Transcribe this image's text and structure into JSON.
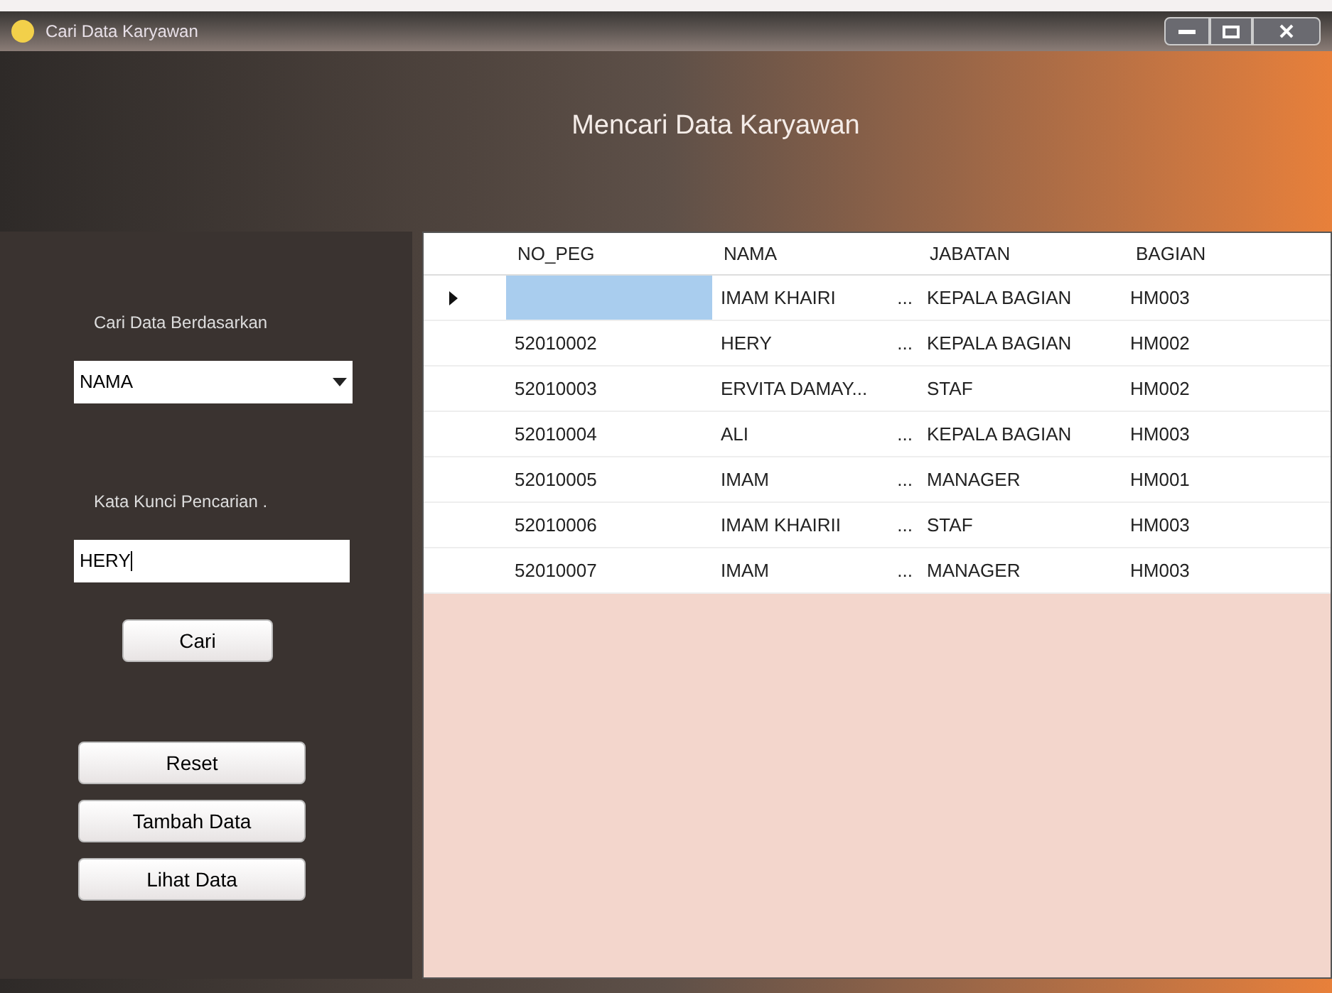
{
  "window": {
    "title": "Cari Data Karyawan"
  },
  "header": {
    "title": "Mencari Data Karyawan"
  },
  "search_panel": {
    "field_label": "Cari Data Berdasarkan",
    "field_value": "NAMA",
    "keyword_label": "Kata Kunci Pencarian .",
    "keyword_value": "HERY",
    "search_button": "Cari"
  },
  "buttons": [
    "Reset",
    "Tambah Data",
    "Lihat Data"
  ],
  "table": {
    "columns": [
      "NO_PEG",
      "NAMA",
      "JABATAN",
      "BAGIAN"
    ],
    "rows": [
      {
        "selected": true,
        "nama": "IMAM KHAIRI",
        "nama_more": "...",
        "jabatan": "KEPALA BAGIAN",
        "bagian": "HM003"
      },
      {
        "selected": false,
        "no_peg": "52010002",
        "nama": "HERY",
        "nama_more": "...",
        "jabatan": "KEPALA BAGIAN",
        "bagian": "HM002"
      },
      {
        "selected": false,
        "no_peg": "52010003",
        "nama": "ERVITA DAMAY...",
        "jabatan": "STAF",
        "bagian": "HM002"
      },
      {
        "selected": false,
        "no_peg": "52010004",
        "nama": "ALI",
        "nama_more": "...",
        "jabatan": "KEPALA BAGIAN",
        "bagian": "HM003"
      },
      {
        "selected": false,
        "no_peg": "52010005",
        "nama": "IMAM",
        "nama_more": "...",
        "jabatan": "MANAGER",
        "bagian": "HM001"
      },
      {
        "selected": false,
        "no_peg": "52010006",
        "nama": "IMAM KHAIRII",
        "nama_more": "...",
        "jabatan": "STAF",
        "bagian": "HM003"
      },
      {
        "selected": false,
        "no_peg": "52010007",
        "nama": "IMAM",
        "nama_more": "...",
        "jabatan": "MANAGER",
        "bagian": "HM003"
      }
    ]
  }
}
